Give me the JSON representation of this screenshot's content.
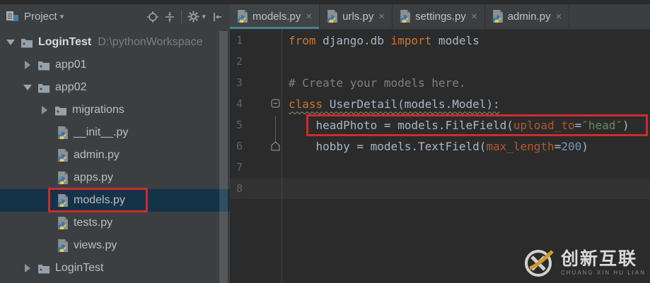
{
  "project_panel": {
    "header": {
      "title": "Project",
      "dropdown_glyph": "▾",
      "buttons": [
        {
          "name": "locate-icon"
        },
        {
          "name": "collapse-all-icon"
        },
        {
          "name": "settings-icon"
        },
        {
          "name": "hide-panel-icon"
        }
      ]
    },
    "tree": [
      {
        "label": "LoginTest",
        "path": "D:\\pythonWorkspace",
        "type": "folder",
        "arrow": "expanded",
        "level": 0,
        "bold": true
      },
      {
        "label": "app01",
        "type": "folder",
        "arrow": "collapsed",
        "level": 1
      },
      {
        "label": "app02",
        "type": "folder",
        "arrow": "expanded",
        "level": 1
      },
      {
        "label": "migrations",
        "type": "folder",
        "arrow": "collapsed",
        "level": 2
      },
      {
        "label": "__init__.py",
        "type": "python-file",
        "level": 3
      },
      {
        "label": "admin.py",
        "type": "python-file",
        "level": 3
      },
      {
        "label": "apps.py",
        "type": "python-file",
        "level": 3
      },
      {
        "label": "models.py",
        "type": "python-file",
        "level": 3,
        "selected": true
      },
      {
        "label": "tests.py",
        "type": "python-file",
        "level": 3
      },
      {
        "label": "views.py",
        "type": "python-file",
        "level": 3
      },
      {
        "label": "LoginTest",
        "type": "folder",
        "arrow": "collapsed",
        "level": 1
      }
    ]
  },
  "editor": {
    "tabs": [
      {
        "label": "models.py",
        "active": true
      },
      {
        "label": "urls.py",
        "active": false
      },
      {
        "label": "settings.py",
        "active": false
      },
      {
        "label": "admin.py",
        "active": false
      }
    ],
    "close_glyph": "×",
    "lines": [
      {
        "num": "1",
        "segments": [
          {
            "text": "from",
            "style": "keyword"
          },
          {
            "text": " django.db ",
            "style": "plain"
          },
          {
            "text": "import",
            "style": "keyword"
          },
          {
            "text": " models",
            "style": "plain"
          }
        ]
      },
      {
        "num": "2",
        "segments": []
      },
      {
        "num": "3",
        "segments": [
          {
            "text": "# Create your models here.",
            "style": "comment"
          }
        ]
      },
      {
        "num": "4",
        "wavy": true,
        "fold": "collapse",
        "segments": [
          {
            "text": "class",
            "style": "keyword"
          },
          {
            "text": " UserDetail(models.Model):",
            "style": "plain"
          }
        ]
      },
      {
        "num": "5",
        "segments": [
          {
            "text": "    headPhoto = models.FileField(",
            "style": "plain"
          },
          {
            "text": "upload_to",
            "style": "kwarg"
          },
          {
            "text": "=",
            "style": "plain"
          },
          {
            "text": "″head″",
            "style": "string"
          },
          {
            "text": ")",
            "style": "plain"
          }
        ]
      },
      {
        "num": "6",
        "fold": "end",
        "segments": [
          {
            "text": "    hobby = models.TextField(",
            "style": "plain"
          },
          {
            "text": "max_length",
            "style": "kwarg"
          },
          {
            "text": "=",
            "style": "plain"
          },
          {
            "text": "200",
            "style": "number"
          },
          {
            "text": ")",
            "style": "plain"
          }
        ]
      },
      {
        "num": "7",
        "segments": []
      },
      {
        "num": "8",
        "current": true,
        "segments": []
      }
    ]
  },
  "annotations": [
    {
      "target": "tree-item-models-py",
      "shape": "red-box"
    },
    {
      "target": "code-line-5",
      "shape": "red-box"
    }
  ],
  "watermark": {
    "brand": "创新互联",
    "subtitle": "CHUANG XIN HU LIAN"
  },
  "colors": {
    "annotation_red": "#CE2B2B",
    "selection_blue": "#143349",
    "active_tab_underline": "#45818E",
    "keyword_orange": "#CC7832",
    "string_green": "#6A8759",
    "kwarg_rust": "#B3592E",
    "number_blue": "#6897BB",
    "python_blue": "#3A76A8",
    "python_yellow": "#F2C63C"
  }
}
